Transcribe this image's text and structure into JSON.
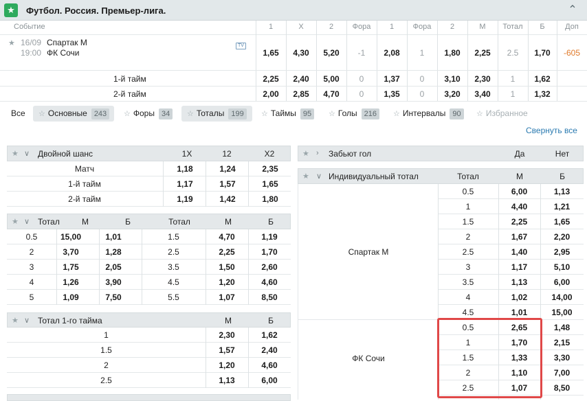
{
  "header": {
    "star": "★",
    "title": "Футбол. Россия. Премьер-лига.",
    "collapse": "^"
  },
  "columns": [
    "Событие",
    "1",
    "X",
    "2",
    "Фора",
    "1",
    "Фора",
    "2",
    "М",
    "Тотал",
    "Б",
    "Доп"
  ],
  "event": {
    "date": "16/09",
    "time": "19:00",
    "team1": "Спартак М",
    "team2": "ФК Сочи",
    "tv": "TV",
    "odds": [
      "1,65",
      "4,30",
      "5,20",
      "-1",
      "2,08",
      "1",
      "1,80",
      "2,25",
      "2.5",
      "1,70",
      "-605"
    ]
  },
  "halves": [
    {
      "label": "1-й тайм",
      "odds": [
        "2,25",
        "2,40",
        "5,00",
        "0",
        "1,37",
        "0",
        "3,10",
        "2,30",
        "1",
        "1,62"
      ]
    },
    {
      "label": "2-й тайм",
      "odds": [
        "2,00",
        "2,85",
        "4,70",
        "0",
        "1,35",
        "0",
        "3,20",
        "3,40",
        "1",
        "1,32"
      ]
    }
  ],
  "filters": {
    "all": "Все",
    "chips": [
      {
        "label": "Основные",
        "count": "243"
      },
      {
        "label": "Форы",
        "count": "34"
      },
      {
        "label": "Тоталы",
        "count": "199"
      },
      {
        "label": "Таймы",
        "count": "95"
      },
      {
        "label": "Голы",
        "count": "216"
      },
      {
        "label": "Интервалы",
        "count": "90"
      },
      {
        "label": "Избранное",
        "count": ""
      }
    ],
    "collapse_all": "Свернуть все"
  },
  "double_chance": {
    "title": "Двойной шанс",
    "cols": [
      "1X",
      "12",
      "X2"
    ],
    "rows": [
      {
        "label": "Матч",
        "vals": [
          "1,18",
          "1,24",
          "2,35"
        ]
      },
      {
        "label": "1-й тайм",
        "vals": [
          "1,17",
          "1,57",
          "1,65"
        ]
      },
      {
        "label": "2-й тайм",
        "vals": [
          "1,19",
          "1,42",
          "1,80"
        ]
      }
    ]
  },
  "totals": {
    "title": "Тотал",
    "cols": [
      "М",
      "Б",
      "Тотал",
      "М",
      "Б"
    ],
    "rows": [
      [
        "0.5",
        "15,00",
        "1,01",
        "1.5",
        "4,70",
        "1,19"
      ],
      [
        "2",
        "3,70",
        "1,28",
        "2.5",
        "2,25",
        "1,70"
      ],
      [
        "3",
        "1,75",
        "2,05",
        "3.5",
        "1,50",
        "2,60"
      ],
      [
        "4",
        "1,26",
        "3,90",
        "4.5",
        "1,20",
        "4,60"
      ],
      [
        "5",
        "1,09",
        "7,50",
        "5.5",
        "1,07",
        "8,50"
      ]
    ]
  },
  "total_1st": {
    "title": "Тотал 1-го тайма",
    "cols": [
      "М",
      "Б"
    ],
    "rows": [
      [
        "1",
        "2,30",
        "1,62"
      ],
      [
        "1.5",
        "1,57",
        "2,40"
      ],
      [
        "2",
        "1,20",
        "4,60"
      ],
      [
        "2.5",
        "1,13",
        "6,00"
      ]
    ]
  },
  "will_score": {
    "title": "Забьют гол",
    "cols": [
      "Да",
      "Нет"
    ]
  },
  "individual_total": {
    "title": "Индивидуальный тотал",
    "cols": [
      "Тотал",
      "М",
      "Б"
    ],
    "teams": [
      {
        "name": "Спартак М",
        "rows": [
          [
            "0.5",
            "6,00",
            "1,13"
          ],
          [
            "1",
            "4,40",
            "1,21"
          ],
          [
            "1.5",
            "2,25",
            "1,65"
          ],
          [
            "2",
            "1,67",
            "2,20"
          ],
          [
            "2.5",
            "1,40",
            "2,95"
          ],
          [
            "3",
            "1,17",
            "5,10"
          ],
          [
            "3.5",
            "1,13",
            "6,00"
          ],
          [
            "4",
            "1,02",
            "14,00"
          ],
          [
            "4.5",
            "1,01",
            "15,00"
          ]
        ]
      },
      {
        "name": "ФК Сочи",
        "rows": [
          [
            "0.5",
            "2,65",
            "1,48"
          ],
          [
            "1",
            "1,70",
            "2,15"
          ],
          [
            "1.5",
            "1,33",
            "3,30"
          ],
          [
            "2",
            "1,10",
            "7,00"
          ],
          [
            "2.5",
            "1,07",
            "8,50"
          ]
        ]
      }
    ]
  },
  "colors": {
    "accent_green": "#2eaa5d",
    "highlight_red": "#e04848",
    "link_blue": "#2a7ab0",
    "negative_orange": "#e07a2a"
  }
}
